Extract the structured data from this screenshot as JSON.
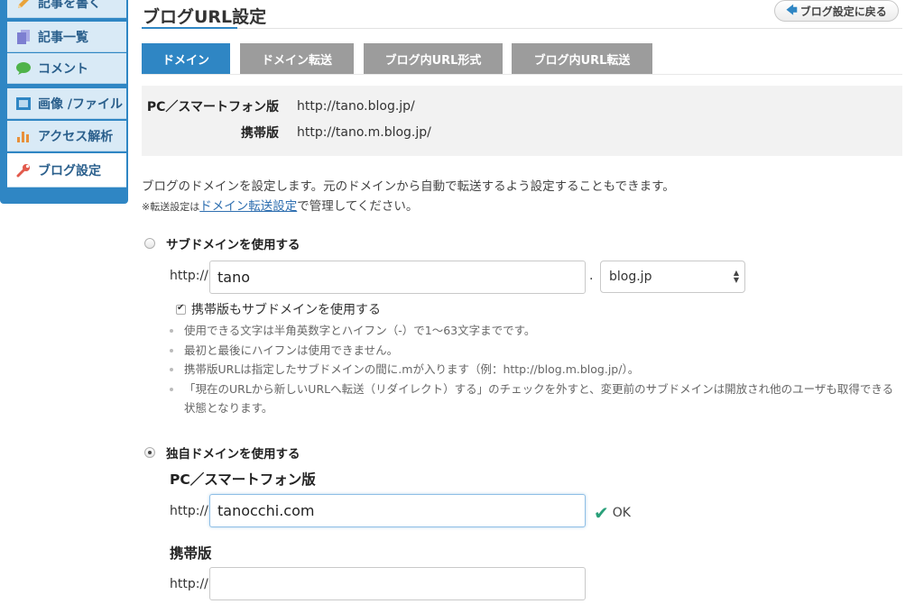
{
  "sidebar": {
    "items": [
      {
        "label": "記事を書く",
        "icon": "pencil-icon",
        "color": "#e8a33a"
      },
      {
        "label": "記事一覧",
        "icon": "documents-icon",
        "color": "#7d7fd1"
      },
      {
        "label": "コメント",
        "icon": "speech-bubble-icon",
        "color": "#4fb34a"
      },
      {
        "label": "画像 /ファイル",
        "icon": "image-file-icon",
        "color": "#2f86c4"
      },
      {
        "label": "アクセス解析",
        "icon": "bar-chart-icon",
        "color": "#e8903a"
      },
      {
        "label": "ブログ設定",
        "icon": "wrench-icon",
        "color": "#e25a4c"
      }
    ]
  },
  "header": {
    "title": "ブログURL設定",
    "back_label": "ブログ設定に戻る"
  },
  "tabs": [
    {
      "label": "ドメイン",
      "active": true
    },
    {
      "label": "ドメイン転送",
      "active": false
    },
    {
      "label": "ブログ内URL形式",
      "active": false
    },
    {
      "label": "ブログ内URL転送",
      "active": false
    }
  ],
  "info": {
    "pc_label": "PC／スマートフォン版",
    "pc_value": "http://tano.blog.jp/",
    "mobile_label": "携帯版",
    "mobile_value": "http://tano.m.blog.jp/"
  },
  "description": {
    "line1": "ブログのドメインを設定します。元のドメインから自動で転送するよう設定することもできます。",
    "line2_prefix": "※転送設定は",
    "line2_link": "ドメイン転送設定",
    "line2_suffix": "で管理してください。"
  },
  "subdomain": {
    "radio_label": "サブドメインを使用する",
    "prefix": "http://",
    "value": "tano",
    "separator": ".",
    "domain_select": "blog.jp",
    "mobile_checkbox_label": "携帯版もサブドメインを使用する",
    "notes": [
      "使用できる文字は半角英数字とハイフン（-）で1〜63文字までです。",
      "最初と最後にハイフンは使用できません。",
      "携帯版URLは指定したサブドメインの間に.mが入ります（例：http://blog.m.blog.jp/）。",
      "「現在のURLから新しいURLへ転送（リダイレクト）する」のチェックを外すと、変更前のサブドメインは開放され他のユーザも取得できる状態となります。"
    ]
  },
  "custom_domain": {
    "radio_label": "独自ドメインを使用する",
    "pc_heading": "PC／スマートフォン版",
    "pc_prefix": "http://",
    "pc_value": "tanocchi.com",
    "ok_label": "OK",
    "mobile_heading": "携帯版",
    "mobile_prefix": "http://",
    "mobile_value": ""
  },
  "colors": {
    "accent": "#2f86c4",
    "tab_inactive": "#9c9c9c",
    "ok_green": "#2aa07a"
  }
}
